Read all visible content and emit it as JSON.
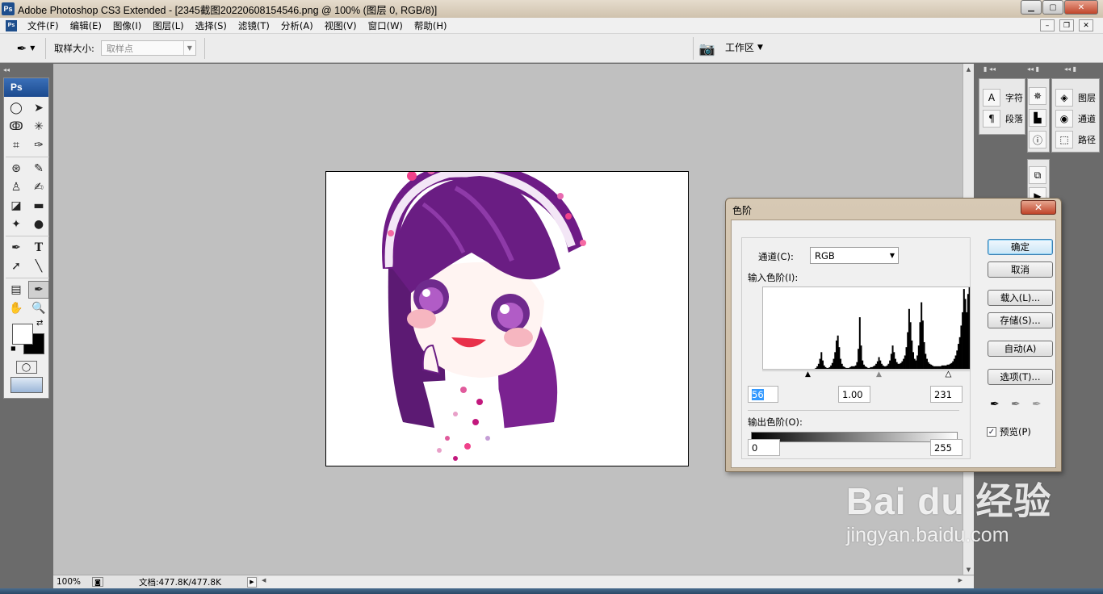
{
  "window": {
    "app_logo": "Ps",
    "title": "Adobe Photoshop CS3 Extended - [2345截图20220608154546.png @ 100% (图层 0, RGB/8)]",
    "minimize_icon": "minimize-icon",
    "maximize_icon": "maximize-icon",
    "close_icon": "close-icon"
  },
  "menubar": {
    "doc_icon": "Ps",
    "items": [
      "文件(F)",
      "编辑(E)",
      "图像(I)",
      "图层(L)",
      "选择(S)",
      "滤镜(T)",
      "分析(A)",
      "视图(V)",
      "窗口(W)",
      "帮助(H)"
    ]
  },
  "options": {
    "tool_icon": "eyedropper-icon",
    "sample_size_label": "取样大小:",
    "sample_size_value": "取样点",
    "workspace_label": "工作区"
  },
  "toolbox": {
    "badge": "Ps",
    "foreground_color": "#ffffff",
    "background_color": "#000000"
  },
  "panels": {
    "col1": [
      {
        "icon": "character-icon",
        "label": "字符"
      },
      {
        "icon": "paragraph-icon",
        "label": "段落"
      }
    ],
    "col3": [
      {
        "icon": "layers-icon",
        "label": "图层"
      },
      {
        "icon": "channels-icon",
        "label": "通道"
      },
      {
        "icon": "paths-icon",
        "label": "路径"
      }
    ]
  },
  "status": {
    "zoom": "100%",
    "doc_info": "文档:477.8K/477.8K"
  },
  "levels_dialog": {
    "title": "色阶",
    "channel_label": "通道(C):",
    "channel_value": "RGB",
    "input_label": "输入色阶(I):",
    "input_black": "56",
    "input_gamma": "1.00",
    "input_white": "231",
    "output_label": "输出色阶(O):",
    "output_black": "0",
    "output_white": "255",
    "buttons": {
      "ok": "确定",
      "cancel": "取消",
      "load": "载入(L)...",
      "save": "存储(S)...",
      "auto": "自动(A)",
      "options": "选项(T)..."
    },
    "preview_label": "预览(P)",
    "preview_checked": true,
    "histogram": [
      0,
      0,
      0,
      0,
      0,
      0,
      0,
      0,
      0,
      0,
      0,
      0,
      0,
      0,
      0,
      0,
      0,
      0,
      0,
      0,
      0,
      0,
      0,
      0,
      0,
      0,
      0,
      0,
      0,
      0,
      0,
      0,
      0,
      0,
      0,
      0,
      1,
      2,
      3,
      5,
      8,
      14,
      22,
      12,
      6,
      4,
      3,
      3,
      4,
      6,
      9,
      14,
      22,
      36,
      42,
      28,
      14,
      8,
      5,
      4,
      3,
      3,
      3,
      4,
      5,
      5,
      5,
      6,
      10,
      26,
      64,
      30,
      12,
      7,
      5,
      4,
      3,
      3,
      4,
      4,
      5,
      6,
      8,
      11,
      16,
      12,
      8,
      6,
      5,
      5,
      6,
      8,
      12,
      20,
      30,
      22,
      14,
      10,
      8,
      8,
      9,
      11,
      14,
      18,
      28,
      46,
      74,
      58,
      36,
      22,
      14,
      12,
      18,
      30,
      58,
      82,
      60,
      34,
      20,
      14,
      10,
      8,
      7,
      6,
      5,
      5,
      5,
      5,
      5,
      5,
      6,
      6,
      6,
      6,
      7,
      7,
      8,
      9,
      11,
      14,
      18,
      24,
      32,
      40,
      54,
      70,
      98,
      86,
      70,
      92,
      100,
      96
    ],
    "histogram_bin_count": 152
  },
  "watermark": {
    "main": "Bai du 经验",
    "sub": "jingyan.baidu.com"
  }
}
